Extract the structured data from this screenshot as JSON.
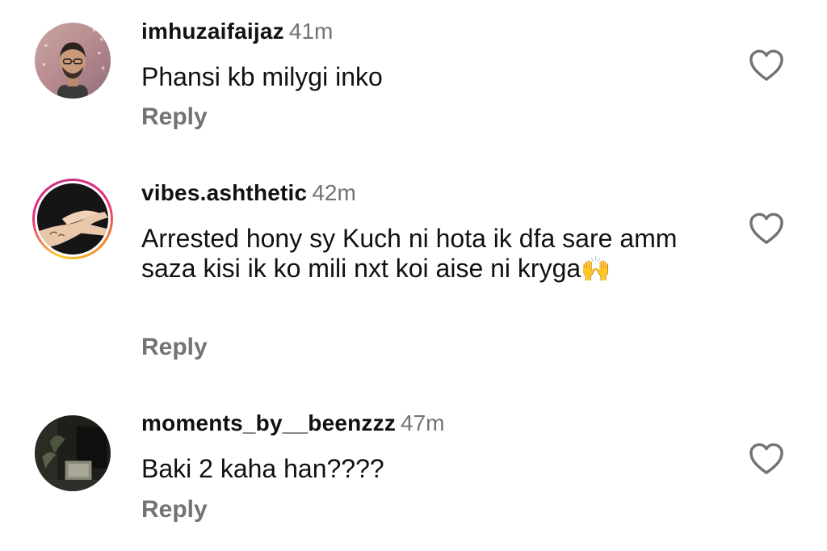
{
  "comments": [
    {
      "username": "imhuzaifaijaz",
      "time": "41m",
      "text": "Phansi kb milygi inko",
      "reply_label": "Reply",
      "avatar_icon": "profile-photo-man",
      "has_story_ring": false,
      "like_icon": "heart-outline-icon"
    },
    {
      "username": "vibes.ashthetic",
      "time": "42m",
      "text": "Arrested hony sy Kuch ni hota ik dfa sare amm saza kisi ik ko mili nxt koi aise ni kryga",
      "emoji": "🙌",
      "reply_label": "Reply",
      "avatar_icon": "profile-photo-hand",
      "has_story_ring": true,
      "like_icon": "heart-outline-icon"
    },
    {
      "username": "moments_by__beenzzz",
      "time": "47m",
      "text": "Baki 2 kaha han????",
      "reply_label": "Reply",
      "avatar_icon": "profile-photo-dark-room",
      "has_story_ring": false,
      "like_icon": "heart-outline-icon"
    }
  ],
  "colors": {
    "text": "#111111",
    "muted": "#737373",
    "background": "#ffffff",
    "story_ring": [
      "#f9ce34",
      "#ee2a7b",
      "#c13584"
    ]
  }
}
